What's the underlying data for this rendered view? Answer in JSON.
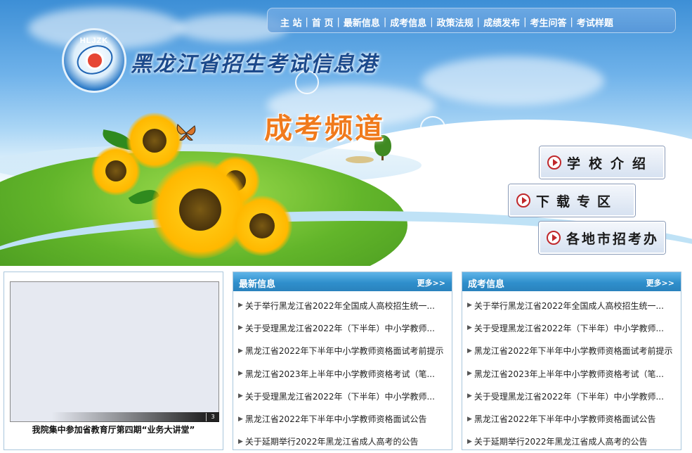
{
  "header": {
    "logo_text": "HLJZK",
    "site_title": "黑龙江省招生考试信息港",
    "channel_title": "成考频道"
  },
  "nav": {
    "items": [
      "主 站",
      "首 页",
      "最新信息",
      "成考信息",
      "政策法规",
      "成绩发布",
      "考生问答",
      "考试样题"
    ],
    "separator": "|"
  },
  "side_buttons": {
    "school": "学校介绍",
    "download": "下载专区",
    "office": "各地市招考办"
  },
  "photo": {
    "caption": "我院集中参加省教育厅第四期“业务大讲堂”",
    "page_number": "3"
  },
  "latest": {
    "title": "最新信息",
    "more": "更多>>",
    "items": [
      "关于举行黑龙江省2022年全国成人高校招生统一...",
      "关于受理黑龙江省2022年（下半年）中小学教师...",
      "黑龙江省2022年下半年中小学教师资格面试考前提示",
      "黑龙江省2023年上半年中小学教师资格考试（笔...",
      "关于受理黑龙江省2022年（下半年）中小学教师...",
      "黑龙江省2022年下半年中小学教师资格面试公告",
      "关于延期举行2022年黑龙江省成人高考的公告"
    ]
  },
  "adult": {
    "title": "成考信息",
    "more": "更多>>",
    "items": [
      "关于举行黑龙江省2022年全国成人高校招生统一...",
      "关于受理黑龙江省2022年（下半年）中小学教师...",
      "黑龙江省2022年下半年中小学教师资格面试考前提示",
      "黑龙江省2023年上半年中小学教师资格考试（笔...",
      "关于受理黑龙江省2022年（下半年）中小学教师...",
      "黑龙江省2022年下半年中小学教师资格面试公告",
      "关于延期举行2022年黑龙江省成人高考的公告"
    ]
  }
}
